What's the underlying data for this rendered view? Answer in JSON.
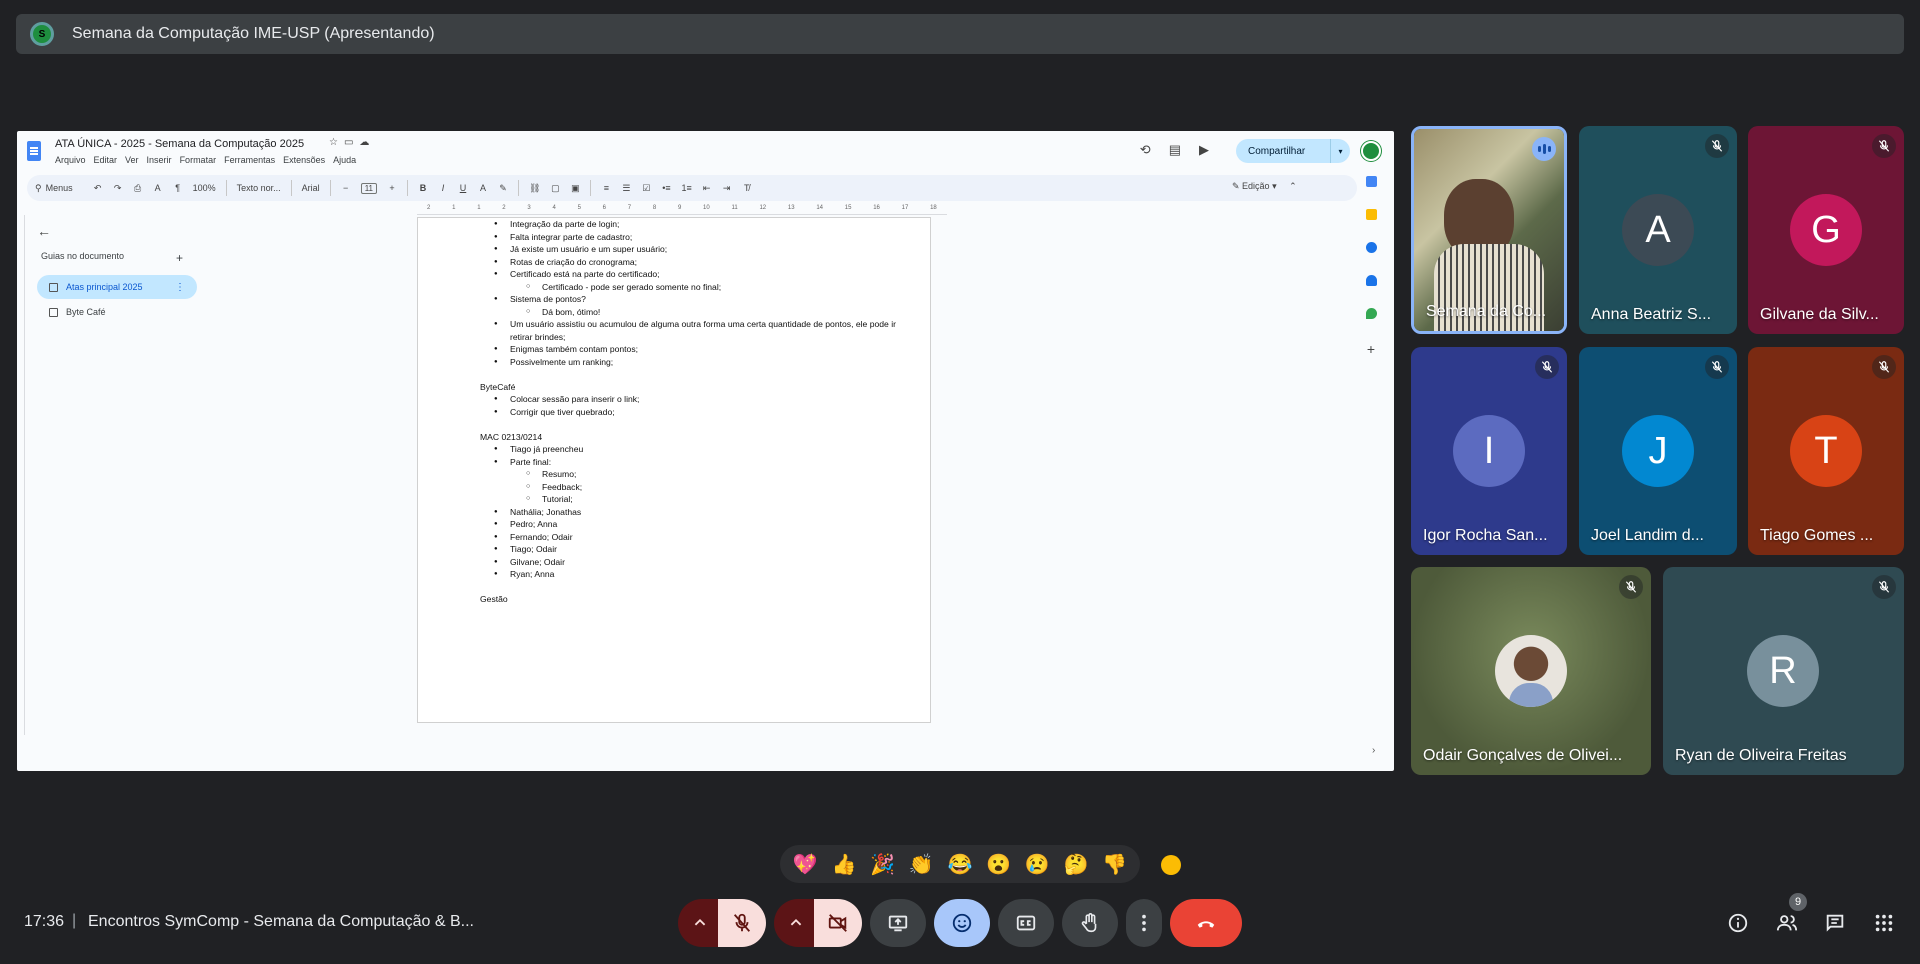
{
  "presenter": {
    "badge": "S",
    "title": "Semana da Computação IME-USP (Apresentando)"
  },
  "docs": {
    "title": "ATA ÚNICA - 2025 - Semana da Computação 2025",
    "menu": [
      "Arquivo",
      "Editar",
      "Ver",
      "Inserir",
      "Formatar",
      "Ferramentas",
      "Extensões",
      "Ajuda"
    ],
    "share_label": "Compartilhar",
    "toolbar": {
      "search": "Menus",
      "zoom": "100%",
      "style": "Texto nor...",
      "font": "Arial",
      "font_size": "11",
      "mode": "Edição"
    },
    "ruler_ticks": [
      "2",
      "1",
      "1",
      "2",
      "3",
      "4",
      "5",
      "6",
      "7",
      "8",
      "9",
      "10",
      "11",
      "12",
      "13",
      "14",
      "15",
      "16",
      "17",
      "18"
    ],
    "sidebar": {
      "heading": "Guias no documento",
      "tabs": [
        "Atas principal 2025",
        "Byte Café"
      ]
    },
    "body": [
      {
        "k": "l1",
        "t": "Integração da parte de login;"
      },
      {
        "k": "l1",
        "t": "Falta integrar parte de cadastro;"
      },
      {
        "k": "l1",
        "t": "Já existe um usuário e um super usuário;"
      },
      {
        "k": "l1",
        "t": "Rotas de criação do cronograma;"
      },
      {
        "k": "l1",
        "t": "Certificado está na parte do certificado;"
      },
      {
        "k": "l2",
        "t": "Certificado - pode ser gerado somente no final;"
      },
      {
        "k": "l1",
        "t": "Sistema de pontos?"
      },
      {
        "k": "l2",
        "t": "Dá bom, ótimo!"
      },
      {
        "k": "l1",
        "t": "Um usuário assistiu ou acumulou de alguma outra forma uma certa quantidade de pontos, ele pode ir retirar brindes;"
      },
      {
        "k": "l1",
        "t": "Enigmas também contam pontos;"
      },
      {
        "k": "l1",
        "t": "Possivelmente um ranking;"
      },
      {
        "k": "gap",
        "t": ""
      },
      {
        "k": "h",
        "t": "ByteCafé"
      },
      {
        "k": "l1",
        "t": "Colocar sessão para inserir o link;"
      },
      {
        "k": "l1",
        "t": "Corrigir que tiver quebrado;"
      },
      {
        "k": "gap",
        "t": ""
      },
      {
        "k": "h",
        "t": "MAC 0213/0214"
      },
      {
        "k": "l1",
        "t": "Tiago já preencheu"
      },
      {
        "k": "l1",
        "t": "Parte final:"
      },
      {
        "k": "l2",
        "t": "Resumo;"
      },
      {
        "k": "l2",
        "t": "Feedback;"
      },
      {
        "k": "l2",
        "t": "Tutorial;"
      },
      {
        "k": "l1",
        "t": "Nathália; Jonathas"
      },
      {
        "k": "l1",
        "t": "Pedro; Anna"
      },
      {
        "k": "l1",
        "t": "Fernando; Odair"
      },
      {
        "k": "l1",
        "t": "Tiago; Odair"
      },
      {
        "k": "l1",
        "t": "Gilvane; Odair"
      },
      {
        "k": "l1",
        "t": "Ryan; Anna"
      },
      {
        "k": "gap",
        "t": ""
      },
      {
        "k": "h",
        "t": "Gestão"
      }
    ]
  },
  "participants": [
    {
      "name": "Semana da Co...",
      "initial": "",
      "type": "camera",
      "speaking": true
    },
    {
      "name": "Anna Beatriz S...",
      "initial": "A",
      "color": "#3c4a55",
      "bg": "#1f4f5c"
    },
    {
      "name": "Gilvane da Silv...",
      "initial": "G",
      "color": "#c2185b",
      "bg": "#6d1535"
    },
    {
      "name": "Igor Rocha San...",
      "initial": "I",
      "color": "#5c6bc0",
      "bg": "#2e3a8c"
    },
    {
      "name": "Joel Landim d...",
      "initial": "J",
      "color": "#0288d1",
      "bg": "#0d4e72"
    },
    {
      "name": "Tiago Gomes ...",
      "initial": "T",
      "color": "#d84315",
      "bg": "#7a2a12"
    },
    {
      "name": "Odair Gonçalves de Olivei...",
      "initial": "",
      "type": "photo",
      "bg": "#4e5a3a"
    },
    {
      "name": "Ryan de Oliveira Freitas",
      "initial": "R",
      "color": "#78909c",
      "bg": "#2f4a52"
    }
  ],
  "reactions": [
    "💖",
    "👍",
    "🎉",
    "👏",
    "😂",
    "😮",
    "😢",
    "🤔",
    "👎"
  ],
  "bottom": {
    "time": "17:36",
    "separator": "|",
    "meeting": "Encontros SymComp - Semana da Computação & B...",
    "people_count": "9"
  }
}
